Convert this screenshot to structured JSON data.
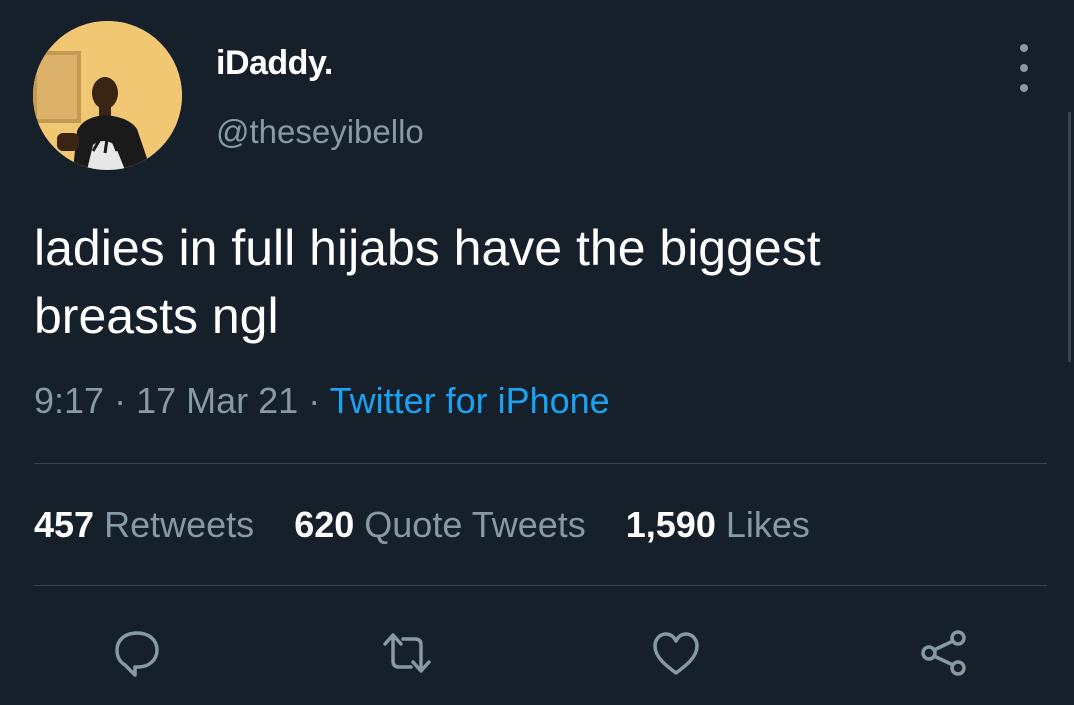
{
  "profile": {
    "display_name": "iDaddy.",
    "handle": "@theseyibello",
    "avatar_icon": "profile-photo"
  },
  "tweet": {
    "text_line1": "ladies in full hijabs have the biggest",
    "text_line2": "breasts ngl",
    "time": "9:17",
    "separator": "·",
    "date": "17 Mar 21",
    "source": "Twitter for iPhone"
  },
  "stats": {
    "retweets_count": "457",
    "retweets_label": "Retweets",
    "quotes_count": "620",
    "quotes_label": "Quote Tweets",
    "likes_count": "1,590",
    "likes_label": "Likes"
  },
  "actions": {
    "reply_icon": "reply-icon",
    "retweet_icon": "retweet-icon",
    "like_icon": "heart-icon",
    "share_icon": "share-icon"
  },
  "colors": {
    "background": "#15202b",
    "primary_text": "#ffffff",
    "secondary_text": "#8899a6",
    "accent": "#1da1f2",
    "divider": "#38444d"
  }
}
